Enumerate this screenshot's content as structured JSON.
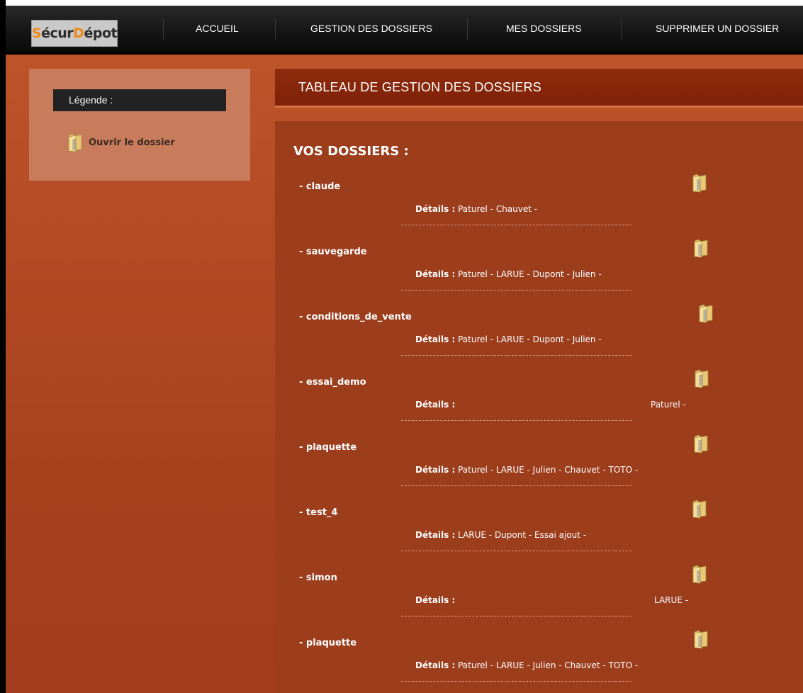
{
  "app": {
    "logo_left": "Sécur",
    "logo_accent_1": "S",
    "logo_accent_2": "D",
    "logo_mid": "écur",
    "logo_end": "épot"
  },
  "nav": {
    "items": [
      {
        "label": "ACCUEIL"
      },
      {
        "label": "GESTION DES DOSSIERS"
      },
      {
        "label": "MES DOSSIERS"
      },
      {
        "label": "SUPPRIMER UN DOSSIER"
      }
    ]
  },
  "sidebar": {
    "legend_title": "Légende :",
    "legend_item": "Ouvrir le dossier",
    "legend_icon": "folder-icon"
  },
  "main": {
    "header_title": "TABLEAU DE GESTION DES DOSSIERS",
    "section_title": "VOS DOSSIERS :",
    "details_label": "Détails :",
    "folders": [
      {
        "name": "- claude",
        "members": "Paturel - Chauvet -",
        "align": "left"
      },
      {
        "name": "- sauvegarde",
        "members": "Paturel - LARUE - Dupont - Julien -",
        "align": "left"
      },
      {
        "name": "- conditions_de_vente",
        "members": "Paturel - LARUE - Dupont - Julien -",
        "align": "left"
      },
      {
        "name": "- essai_demo",
        "members": "Paturel -",
        "align": "right"
      },
      {
        "name": "- plaquette",
        "members": "Paturel - LARUE - Julien - Chauvet - TOTO -",
        "align": "left"
      },
      {
        "name": "- test_4",
        "members": "LARUE - Dupont - Essai ajout -",
        "align": "left"
      },
      {
        "name": "- simon",
        "members": "LARUE -",
        "align": "right"
      },
      {
        "name": "- plaquette",
        "members": "Paturel - LARUE - Julien - Chauvet - TOTO -",
        "align": "left"
      }
    ]
  },
  "colors": {
    "nav_bg": "#141414",
    "page_bg": "#b44a24",
    "header_bg": "#8e2b0d",
    "body_bg": "#9c3d1c",
    "sidebar_bg": "#c87c5c",
    "logo_accent": "#f08a14"
  }
}
